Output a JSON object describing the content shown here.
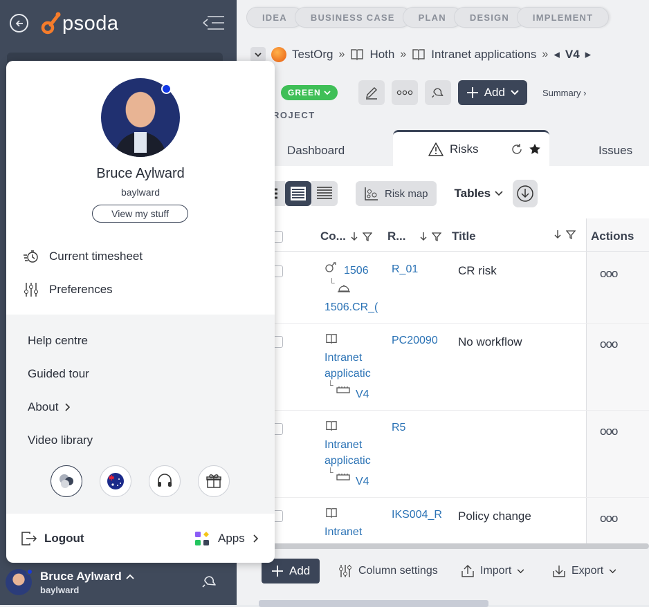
{
  "app": {
    "logo_text": "psoda",
    "accent_color": "#f57c2b",
    "sidebar_color": "#404a5b"
  },
  "stages": [
    "IDEA",
    "BUSINESS CASE",
    "PLAN",
    "DESIGN",
    "IMPLEMENT"
  ],
  "breadcrumb": {
    "items": [
      "TestOrg",
      "Hoth",
      "Intranet applications"
    ],
    "current": "V4"
  },
  "toolbar": {
    "status": "GREEN",
    "add_label": "Add",
    "summary_label": "Summary"
  },
  "project_label": "ROJECT",
  "tabs": {
    "left": "Dashboard",
    "active": "Risks",
    "right": "Issues"
  },
  "view": {
    "risk_map_label": "Risk map",
    "tables_label": "Tables"
  },
  "table": {
    "headers": {
      "code": "Co...",
      "ref": "R...",
      "title": "Title",
      "actions": "Actions"
    },
    "rows": [
      {
        "code_top": "1506",
        "code_bottom": "1506.CR_(",
        "ref": "R_01",
        "title": "CR risk",
        "actions": "ooo"
      },
      {
        "code_top": "Intranet",
        "code_mid": "applicatic",
        "code_bottom": "V4",
        "ref": "PC20090",
        "title": "No workflow",
        "actions": "ooo"
      },
      {
        "code_top": "Intranet",
        "code_mid": "applicatic",
        "code_bottom": "V4",
        "ref": "R5",
        "title": "",
        "actions": "ooo"
      },
      {
        "code_top": "Intranet",
        "ref": "IKS004_R",
        "title": "Policy change",
        "actions": "ooo"
      }
    ]
  },
  "bottom_bar": {
    "add": "Add",
    "column_settings": "Column settings",
    "import": "Import",
    "export": "Export"
  },
  "user_popup": {
    "name": "Bruce Aylward",
    "username": "baylward",
    "view_stuff": "View my stuff",
    "menu": [
      "Current timesheet",
      "Preferences"
    ],
    "help_menu": [
      "Help centre",
      "Guided tour",
      "About",
      "Video library"
    ],
    "logout": "Logout",
    "apps": "Apps"
  },
  "sidebar_user": {
    "name": "Bruce Aylward",
    "username": "baylward"
  }
}
